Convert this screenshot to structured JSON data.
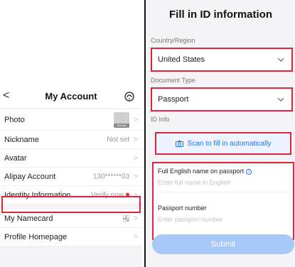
{
  "account": {
    "back_glyph": "<",
    "title": "My Account",
    "rows": [
      {
        "label": "Photo",
        "value": "",
        "thumb_tag": "Not set"
      },
      {
        "label": "Nickname",
        "value": "Not set"
      },
      {
        "label": "Avatar",
        "value": ""
      },
      {
        "label": "Alipay Account",
        "value": "130******03"
      },
      {
        "label": "Identity Information",
        "value": "Verify now"
      },
      {
        "label": "My Namecard",
        "value": ""
      },
      {
        "label": "Profile Homepage",
        "value": ""
      }
    ],
    "chevron": ">"
  },
  "id_form": {
    "title": "Fill in ID information",
    "country_label": "Country/Region",
    "country_value": "United States",
    "doc_label": "Document Type",
    "doc_value": "Passport",
    "id_info_label": "ID Info",
    "scan_label": "Scan to fill in automatically",
    "name_label": "Full English name on passport",
    "info_glyph": "i",
    "name_placeholder": "Enter full name in English",
    "passport_label": "Passport number",
    "passport_placeholder": "Enter passport number",
    "submit_label": "Submit"
  },
  "colors": {
    "highlight": "#d9263a",
    "accent": "#1677ff",
    "submit_bg": "#a8c9f7",
    "badge_dot": "#e0352b"
  },
  "icons": [
    "back-icon",
    "help-icon",
    "chevron-right-icon",
    "qr-code-icon",
    "status-dot-icon",
    "chevron-down-icon",
    "camera-scan-icon",
    "info-icon"
  ]
}
